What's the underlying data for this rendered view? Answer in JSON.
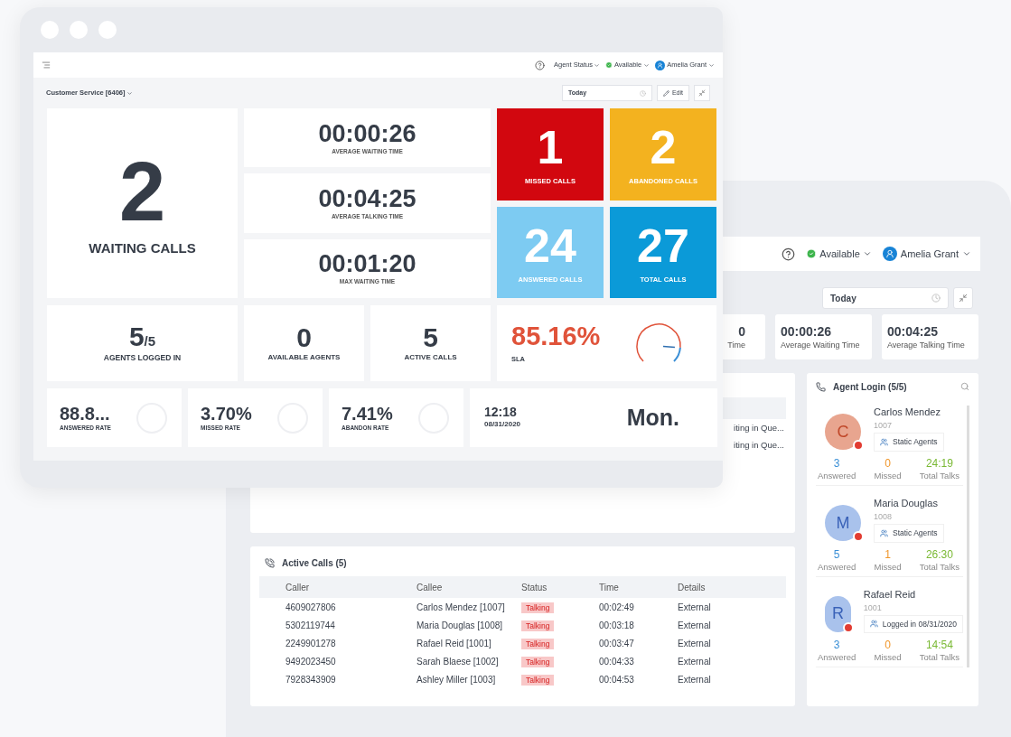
{
  "front_window": {
    "header": {
      "agent_status": "Agent Status",
      "status": "Available",
      "user": "Amelia Grant"
    },
    "queue": "Customer Service [6406]",
    "date_range": "Today",
    "edit": "Edit",
    "waiting": {
      "value": "2",
      "label": "WAITING CALLS"
    },
    "times": [
      {
        "value": "00:00:26",
        "label": "AVERAGE WAITING TIME"
      },
      {
        "value": "00:04:25",
        "label": "AVERAGE TALKING TIME"
      },
      {
        "value": "00:01:20",
        "label": "MAX WAITING TIME"
      }
    ],
    "tiles": [
      {
        "value": "1",
        "label": "MISSED CALLS",
        "color": "#d2070f"
      },
      {
        "value": "2",
        "label": "ABANDONED CALLS",
        "color": "#f3b21f"
      },
      {
        "value": "24",
        "label": "ANSWERED CALLS",
        "color": "#7dcbf2"
      },
      {
        "value": "27",
        "label": "TOTAL CALLS",
        "color": "#0b9ad8"
      }
    ],
    "agents_logged_in": {
      "value": "5",
      "total": "/5",
      "label": "AGENTS LOGGED IN"
    },
    "counts": [
      {
        "value": "0",
        "label": "AVAILABLE AGENTS"
      },
      {
        "value": "5",
        "label": "ACTIVE CALLS"
      }
    ],
    "sla": {
      "value": "85.16%",
      "label": "SLA",
      "level": 0.85
    },
    "rates": [
      {
        "value": "88.8...",
        "label": "ANSWERED RATE"
      },
      {
        "value": "3.70%",
        "label": "MISSED RATE"
      },
      {
        "value": "7.41%",
        "label": "ABANDON RATE"
      }
    ],
    "clock": {
      "time": "12:18",
      "date": "08/31/2020",
      "day": "Mon."
    }
  },
  "back_window": {
    "header": {
      "status": "Available",
      "user": "Amelia Grant"
    },
    "date_range": "Today",
    "stats": [
      {
        "value": "0",
        "label": "Time"
      },
      {
        "value": "00:00:26",
        "label": "Average Waiting Time"
      },
      {
        "value": "00:04:25",
        "label": "Average Talking Time"
      }
    ],
    "queue_rows": [
      "iting in Que...",
      "iting in Que..."
    ],
    "active_calls": {
      "title": "Active Calls (5)",
      "columns": [
        "Caller",
        "Callee",
        "Status",
        "Time",
        "Details"
      ],
      "rows": [
        [
          "4609027806",
          "Carlos Mendez [1007]",
          "Talking",
          "00:02:49",
          "External"
        ],
        [
          "5302119744",
          "Maria Douglas [1008]",
          "Talking",
          "00:03:18",
          "External"
        ],
        [
          "2249901278",
          "Rafael Reid [1001]",
          "Talking",
          "00:03:47",
          "External"
        ],
        [
          "9492023450",
          "Sarah Blaese [1002]",
          "Talking",
          "00:04:33",
          "External"
        ],
        [
          "7928343909",
          "Ashley Miller [1003]",
          "Talking",
          "00:04:53",
          "External"
        ]
      ]
    },
    "agent_login": {
      "title": "Agent Login (5/5)",
      "agents": [
        {
          "initial": "C",
          "color": "#e8a58f",
          "name": "Carlos Mendez",
          "ext": "1007",
          "tag": "Static Agents",
          "stats": [
            {
              "value": "3",
              "label": "Answered"
            },
            {
              "value": "0",
              "label": "Missed"
            },
            {
              "value": "24:19",
              "label": "Total Talks"
            }
          ]
        },
        {
          "initial": "M",
          "color": "#a9c2ec",
          "name": "Maria Douglas",
          "ext": "1008",
          "tag": "Static Agents",
          "stats": [
            {
              "value": "5",
              "label": "Answered"
            },
            {
              "value": "1",
              "label": "Missed"
            },
            {
              "value": "26:30",
              "label": "Total Talks"
            }
          ]
        },
        {
          "initial": "R",
          "color": "#a9c2ec",
          "name": "Rafael Reid",
          "ext": "1001",
          "tag": "Logged in 08/31/2020",
          "stats": [
            {
              "value": "3",
              "label": "Answered"
            },
            {
              "value": "0",
              "label": "Missed"
            },
            {
              "value": "14:54",
              "label": "Total Talks"
            }
          ]
        }
      ]
    }
  }
}
